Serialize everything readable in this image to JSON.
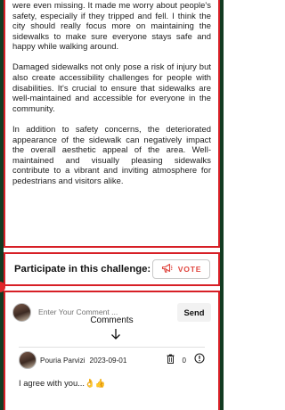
{
  "story": {
    "paragraphs": [
      "were even missing. It made me worry about people's safety, especially if they tripped and fell. I think the city should really focus more on maintaining the sidewalks to make sure everyone stays safe and happy while walking around.",
      "Damaged sidewalks not only pose a risk of injury but also create accessibility challenges for people with disabilities. It's crucial to ensure that sidewalks are well-maintained and accessible for everyone in the community.",
      "In addition to safety concerns, the deteriorated appearance of the sidewalk can negatively impact the overall aesthetic appeal of the area. Well-maintained and visually pleasing sidewalks contribute to a vibrant and inviting atmosphere for pedestrians and visitors alike."
    ]
  },
  "participate": {
    "title": "Participate in this challenge:",
    "vote_label": "VOTE"
  },
  "comment_form": {
    "placeholder": "Enter Your Comment ...",
    "send_label": "Send"
  },
  "comments": {
    "heading": "Comments",
    "items": [
      {
        "author": "Pouria Parvizi",
        "date": "2023-09-01",
        "likes": "0",
        "text": "I agree with you...👌👍"
      }
    ]
  },
  "colors": {
    "accent": "#d71f26",
    "vote": "#e0463f",
    "edge": "#123b22"
  }
}
